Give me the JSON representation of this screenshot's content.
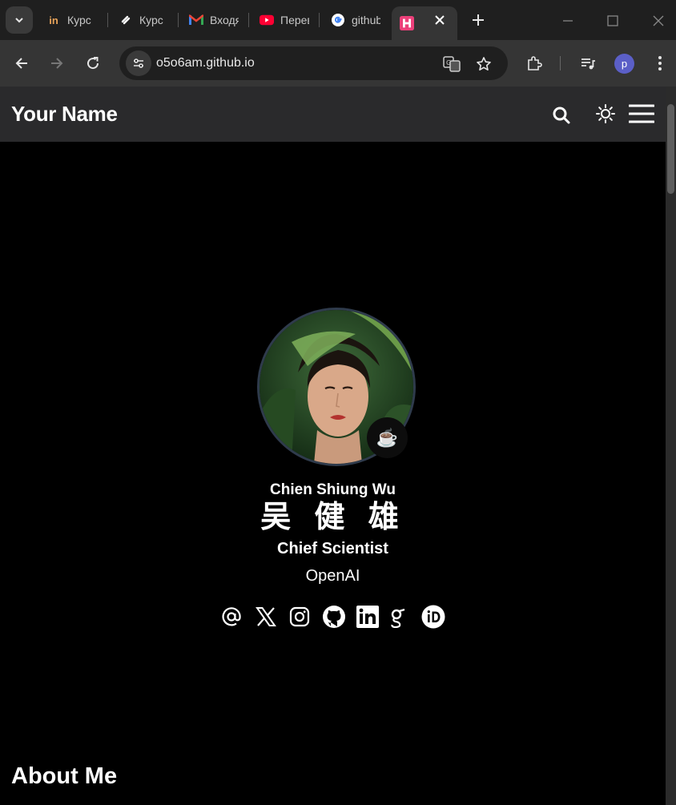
{
  "browser": {
    "tabs": [
      {
        "title": "Курс",
        "icon": "coursera-icon",
        "active": false
      },
      {
        "title": "Курс",
        "icon": "stepik-icon",
        "active": false
      },
      {
        "title": "Входящие",
        "icon": "gmail-icon",
        "active": false
      },
      {
        "title": "Перевод",
        "icon": "youtube-icon",
        "active": false
      },
      {
        "title": "github",
        "icon": "google-icon",
        "active": false
      },
      {
        "title": "",
        "icon": "h-icon",
        "active": true
      }
    ],
    "url": "o5o6am.github.io",
    "profile_initial": "p"
  },
  "header": {
    "brand": "Your Name"
  },
  "profile": {
    "name_latin": "Chien Shiung Wu",
    "name_cjk": "吴 健 雄",
    "role": "Chief Scientist",
    "organization": "OpenAI",
    "status_emoji": "☕"
  },
  "socials": [
    "email-icon",
    "x-icon",
    "instagram-icon",
    "github-icon",
    "linkedin-icon",
    "google-scholar-icon",
    "orcid-icon"
  ],
  "about": {
    "heading": "About Me"
  },
  "colors": {
    "page_bg": "#000000",
    "header_bg": "#2a2a2c",
    "tab_bar_bg": "#1f1f1f",
    "toolbar_bg": "#353535",
    "avatar_border": "#2f3b4c",
    "profile_badge": "#5b5fc7"
  }
}
